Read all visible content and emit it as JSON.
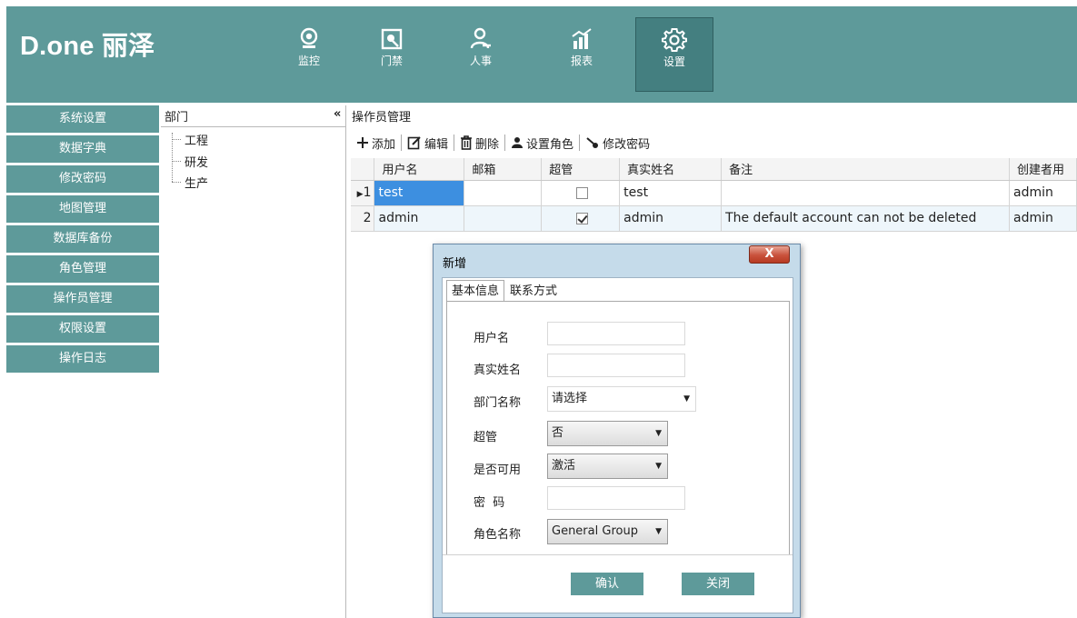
{
  "header": {
    "brand": "D.one 丽泽",
    "nav": [
      {
        "label": "监控",
        "icon": "camera-icon"
      },
      {
        "label": "门禁",
        "icon": "door-access-icon"
      },
      {
        "label": "人事",
        "icon": "person-icon"
      },
      {
        "label": "报表",
        "icon": "report-chart-icon"
      },
      {
        "label": "设置",
        "icon": "gear-icon",
        "active": true
      }
    ]
  },
  "sidebar": {
    "items": [
      {
        "label": "系统设置"
      },
      {
        "label": "数据字典"
      },
      {
        "label": "修改密码"
      },
      {
        "label": "地图管理"
      },
      {
        "label": "数据库备份"
      },
      {
        "label": "角色管理"
      },
      {
        "label": "操作员管理"
      },
      {
        "label": "权限设置"
      },
      {
        "label": "操作日志"
      }
    ]
  },
  "dept": {
    "title": "部门",
    "collapse_glyph": "«",
    "nodes": [
      "工程",
      "研发",
      "生产"
    ]
  },
  "main": {
    "title": "操作员管理",
    "toolbar": {
      "add": "添加",
      "edit": "编辑",
      "delete": "删除",
      "set_role": "设置角色",
      "change_password": "修改密码"
    },
    "table": {
      "columns": [
        "用户名",
        "邮箱",
        "超管",
        "真实姓名",
        "备注",
        "创建者用"
      ],
      "rows": [
        {
          "row_header": "1",
          "username": "test",
          "email": "",
          "super_admin": false,
          "real_name": "test",
          "remark": "",
          "creator": "admin"
        },
        {
          "row_header": "2",
          "username": "admin",
          "email": "",
          "super_admin": true,
          "real_name": "admin",
          "remark": "The default account can not be deleted",
          "creator": "admin"
        }
      ]
    }
  },
  "dialog": {
    "title": "新增",
    "close_label": "X",
    "tabs": [
      "基本信息",
      "联系方式"
    ],
    "fields": {
      "username_label": "用户名",
      "realname_label": "真实姓名",
      "department_label": "部门名称",
      "department_value": "请选择",
      "superadmin_label": "超管",
      "superadmin_value": "否",
      "enabled_label": "是否可用",
      "enabled_value": "激活",
      "password_label": "密  码",
      "role_label": "角色名称",
      "role_value": "General Group"
    },
    "confirm_label": "确认",
    "close_button_label": "关闭"
  }
}
